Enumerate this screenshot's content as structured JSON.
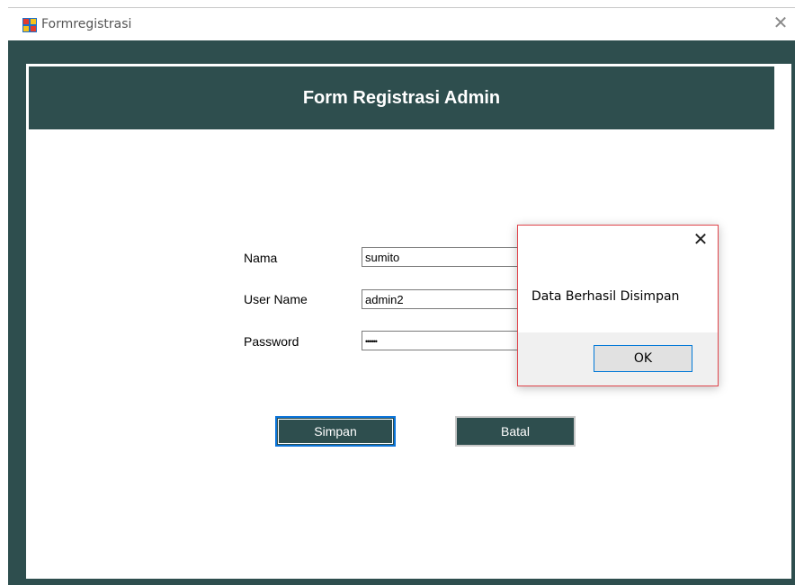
{
  "window": {
    "title": "Formregistrasi",
    "close_glyph": "✕",
    "icon": "windows-form-icon"
  },
  "header": {
    "title": "Form Registrasi Admin"
  },
  "form": {
    "nama_label": "Nama",
    "nama_value": "sumito",
    "username_label": "User Name",
    "username_value": "admin2",
    "password_label": "Password",
    "password_value": "••••••"
  },
  "buttons": {
    "simpan": "Simpan",
    "batal": "Batal"
  },
  "dialog": {
    "message": "Data Berhasil Disimpan",
    "ok_label": "OK",
    "close_glyph": "✕"
  },
  "colors": {
    "theme_dark_teal": "#2e4e4e",
    "focus_blue": "#0a74da",
    "dialog_border_red": "#e0454c"
  }
}
